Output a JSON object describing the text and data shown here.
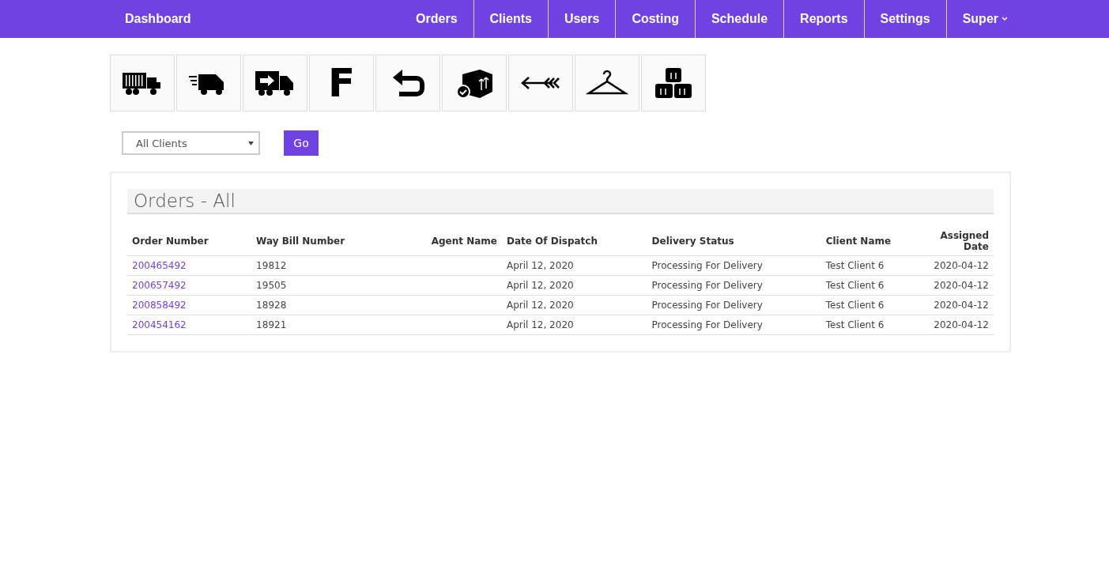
{
  "navbar": {
    "brand": "Dashboard",
    "menu": [
      {
        "label": "Orders",
        "dropdown": false
      },
      {
        "label": "Clients",
        "dropdown": false
      },
      {
        "label": "Users",
        "dropdown": false
      },
      {
        "label": "Costing",
        "dropdown": false
      },
      {
        "label": "Schedule",
        "dropdown": false
      },
      {
        "label": "Reports",
        "dropdown": false
      },
      {
        "label": "Settings",
        "dropdown": false
      },
      {
        "label": "Super",
        "dropdown": true
      }
    ]
  },
  "toolbar": [
    {
      "kind": "container-truck"
    },
    {
      "kind": "fast-van"
    },
    {
      "kind": "forward-truck"
    },
    {
      "kind": "letter",
      "label": "F"
    },
    {
      "kind": "return-arrow"
    },
    {
      "kind": "box-check"
    },
    {
      "kind": "arrow-left"
    },
    {
      "kind": "hanger"
    },
    {
      "kind": "boxes"
    }
  ],
  "filter": {
    "client_select": "All Clients",
    "button": "Go"
  },
  "panel": {
    "title": "Orders - All",
    "table": {
      "columns": [
        "Order Number",
        "Way Bill Number",
        "Agent Name",
        "Date Of Dispatch",
        "Delivery Status",
        "Client Name",
        "Assigned Date"
      ],
      "rows": [
        [
          "200465492",
          "19812",
          "",
          "April 12, 2020",
          "Processing For Delivery",
          "Test Client 6",
          "2020-04-12"
        ],
        [
          "200657492",
          "19505",
          "",
          "April 12, 2020",
          "Processing For Delivery",
          "Test Client 6",
          "2020-04-12"
        ],
        [
          "200858492",
          "18928",
          "",
          "April 12, 2020",
          "Processing For Delivery",
          "Test Client 6",
          "2020-04-12"
        ],
        [
          "200454162",
          "18921",
          "",
          "April 12, 2020",
          "Processing For Delivery",
          "Test Client 6",
          "2020-04-12"
        ]
      ]
    }
  }
}
